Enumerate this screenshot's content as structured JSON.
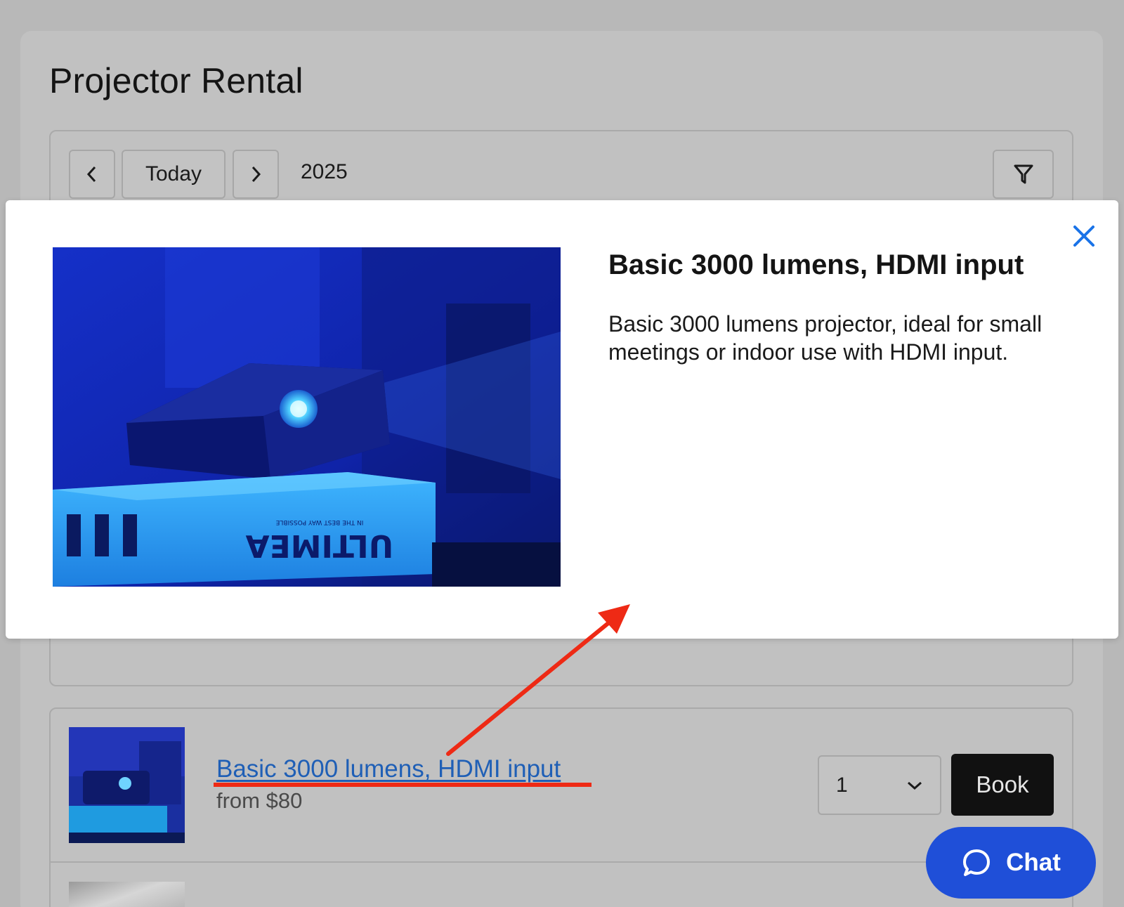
{
  "page": {
    "title": "Projector Rental"
  },
  "toolbar": {
    "today_label": "Today",
    "year": "2025",
    "prev_icon": "chevron-left-icon",
    "next_icon": "chevron-right-icon",
    "filter_icon": "filter-icon"
  },
  "modal": {
    "title": "Basic 3000 lumens, HDMI input",
    "description": "Basic 3000 lumens projector, ideal for small meetings or indoor use with HDMI input.",
    "image_brand_text": "ULTIMEA",
    "image_tagline_text": "IN THE BEST WAY POSSIBLE",
    "close_icon": "close-icon"
  },
  "items": [
    {
      "name": "Basic 3000 lumens, HDMI input",
      "price": "from $80",
      "quantity": "1",
      "book_label": "Book"
    }
  ],
  "chat": {
    "label": "Chat",
    "icon": "chat-bubble-icon"
  },
  "colors": {
    "overlay_bg": "#b8b8b8",
    "link_blue": "#1f5fb6",
    "chat_blue": "#1f4fd8",
    "close_blue": "#1a73e8",
    "annotation_red": "#ee2a15"
  }
}
